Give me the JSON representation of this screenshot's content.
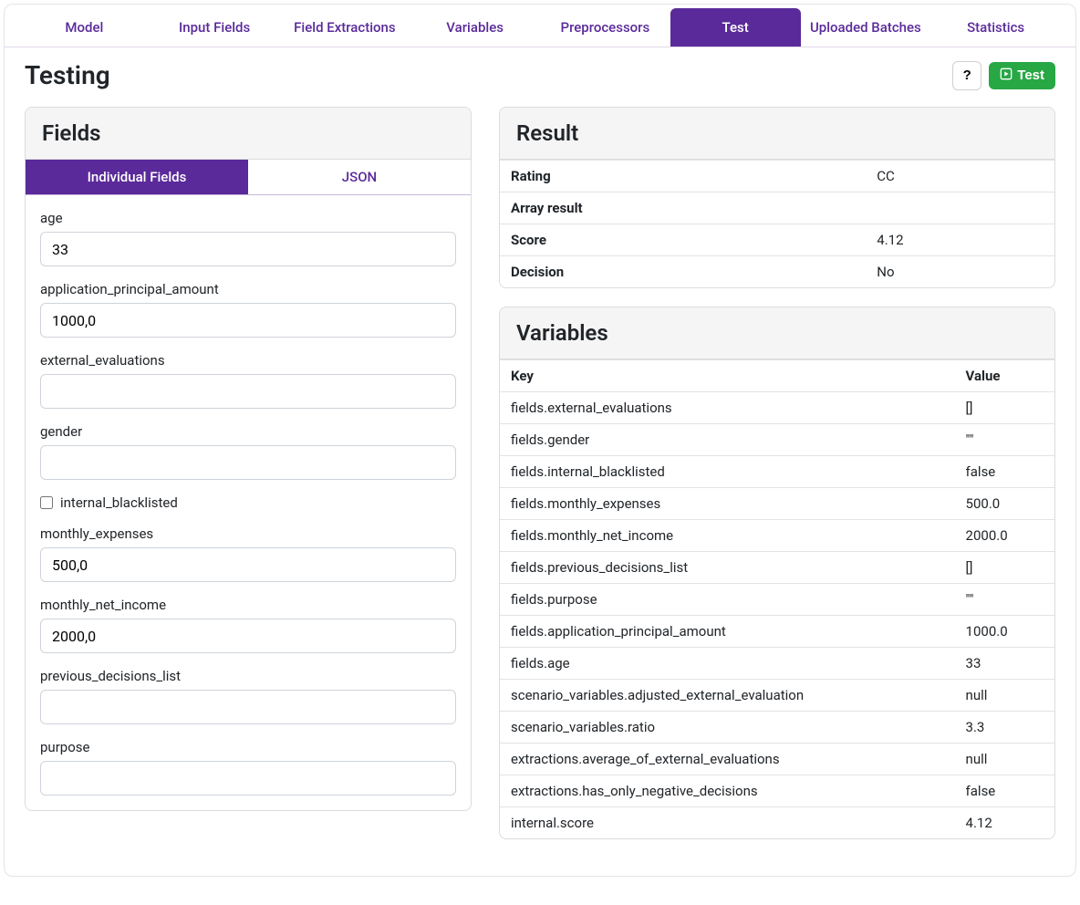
{
  "tabs": {
    "items": [
      "Model",
      "Input Fields",
      "Field Extractions",
      "Variables",
      "Preprocessors",
      "Test",
      "Uploaded Batches",
      "Statistics"
    ],
    "active": "Test"
  },
  "title": "Testing",
  "buttons": {
    "help": "?",
    "test": "Test"
  },
  "fields_card": {
    "title": "Fields",
    "subtabs": {
      "individual": "Individual Fields",
      "json": "JSON",
      "active": "individual"
    },
    "fields": {
      "age": {
        "label": "age",
        "value": "33"
      },
      "application_principal_amount": {
        "label": "application_principal_amount",
        "value": "1000,0"
      },
      "external_evaluations": {
        "label": "external_evaluations",
        "value": ""
      },
      "gender": {
        "label": "gender",
        "value": ""
      },
      "internal_blacklisted": {
        "label": "internal_blacklisted",
        "checked": false
      },
      "monthly_expenses": {
        "label": "monthly_expenses",
        "value": "500,0"
      },
      "monthly_net_income": {
        "label": "monthly_net_income",
        "value": "2000,0"
      },
      "previous_decisions_list": {
        "label": "previous_decisions_list",
        "value": ""
      },
      "purpose": {
        "label": "purpose",
        "value": ""
      }
    }
  },
  "result_card": {
    "title": "Result",
    "rows": {
      "rating": {
        "label": "Rating",
        "value": "CC"
      },
      "array_result": {
        "label": "Array result",
        "value": ""
      },
      "score": {
        "label": "Score",
        "value": "4.12"
      },
      "decision": {
        "label": "Decision",
        "value": "No"
      }
    }
  },
  "variables_card": {
    "title": "Variables",
    "header_key": "Key",
    "header_value": "Value",
    "rows": [
      {
        "key": "fields.external_evaluations",
        "value": "[]"
      },
      {
        "key": "fields.gender",
        "value": "\"\""
      },
      {
        "key": "fields.internal_blacklisted",
        "value": "false"
      },
      {
        "key": "fields.monthly_expenses",
        "value": "500.0"
      },
      {
        "key": "fields.monthly_net_income",
        "value": "2000.0"
      },
      {
        "key": "fields.previous_decisions_list",
        "value": "[]"
      },
      {
        "key": "fields.purpose",
        "value": "\"\""
      },
      {
        "key": "fields.application_principal_amount",
        "value": "1000.0"
      },
      {
        "key": "fields.age",
        "value": "33"
      },
      {
        "key": "scenario_variables.adjusted_external_evaluation",
        "value": "null"
      },
      {
        "key": "scenario_variables.ratio",
        "value": "3.3"
      },
      {
        "key": "extractions.average_of_external_evaluations",
        "value": "null"
      },
      {
        "key": "extractions.has_only_negative_decisions",
        "value": "false"
      },
      {
        "key": "internal.score",
        "value": "4.12"
      }
    ]
  }
}
